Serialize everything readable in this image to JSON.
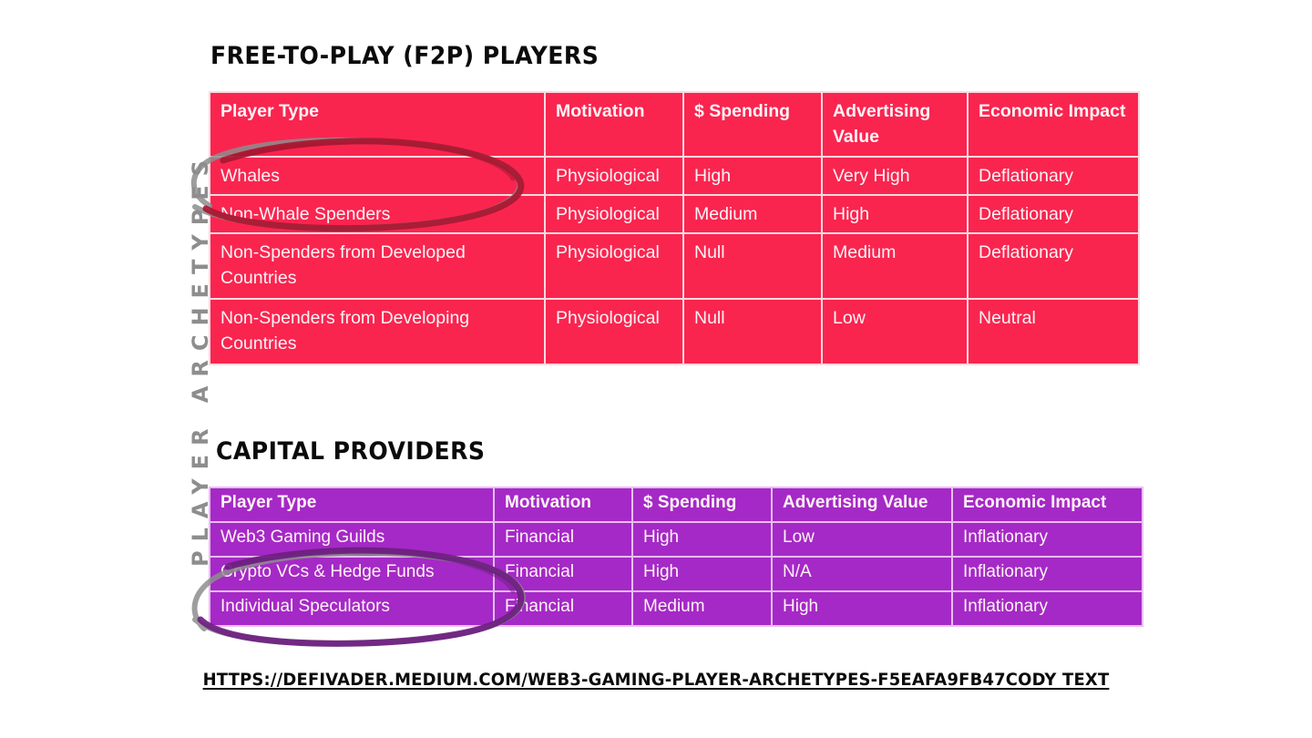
{
  "side_label": "PLAYER ARCHETYPES",
  "colors": {
    "f2p_table": "#F9254F",
    "capital_table": "#A529C6",
    "grid_line_f2p": "#FBD9E1",
    "grid_line_capital": "#E8BDF2",
    "cell_text": "#FDF3F6",
    "title_text": "#0B0B0B",
    "side_label_text": "#8D8D8D",
    "annotation_red_circle": "#A81731",
    "annotation_purple_circle": "#6E2080",
    "annotation_gray_circle": "#8D8D8D"
  },
  "sections": [
    {
      "id": "f2p",
      "title": "FREE-TO-PLAY (F2P) PLAYERS",
      "columns": [
        "Player Type",
        "Motivation",
        "$ Spending",
        "Advertising Value",
        "Economic Impact"
      ],
      "rows": [
        [
          "Whales",
          "Physiological",
          "High",
          "Very High",
          "Deflationary"
        ],
        [
          "Non-Whale Spenders",
          "Physiological",
          "Medium",
          "High",
          "Deflationary"
        ],
        [
          "Non-Spenders from Developed Countries",
          "Physiological",
          "Null",
          "Medium",
          "Deflationary"
        ],
        [
          "Non-Spenders from Developing Countries",
          "Physiological",
          "Null",
          "Low",
          "Neutral"
        ]
      ]
    },
    {
      "id": "capital",
      "title": "CAPITAL PROVIDERS",
      "columns": [
        "Player Type",
        "Motivation",
        "$ Spending",
        "Advertising Value",
        "Economic Impact"
      ],
      "rows": [
        [
          "Web3 Gaming Guilds",
          "Financial",
          "High",
          "Low",
          "Inflationary"
        ],
        [
          "Crypto VCs & Hedge Funds",
          "Financial",
          "High",
          "N/A",
          "Inflationary"
        ],
        [
          "Individual Speculators",
          "Financial",
          "Medium",
          "High",
          "Inflationary"
        ]
      ]
    }
  ],
  "annotations": [
    {
      "name": "circle-highlight-whales-rows",
      "target": "Whales / Non-Whale Spenders"
    },
    {
      "name": "circle-highlight-crypto-vcs-rows",
      "target": "Crypto VCs & Hedge Funds / Individual Speculators"
    }
  ],
  "footer": {
    "url": "HTTPS://DEFIVADER.MEDIUM.COM/WEB3-GAMING-PLAYER-ARCHETYPES-F5EAFA9FB47CODY TEXT"
  }
}
